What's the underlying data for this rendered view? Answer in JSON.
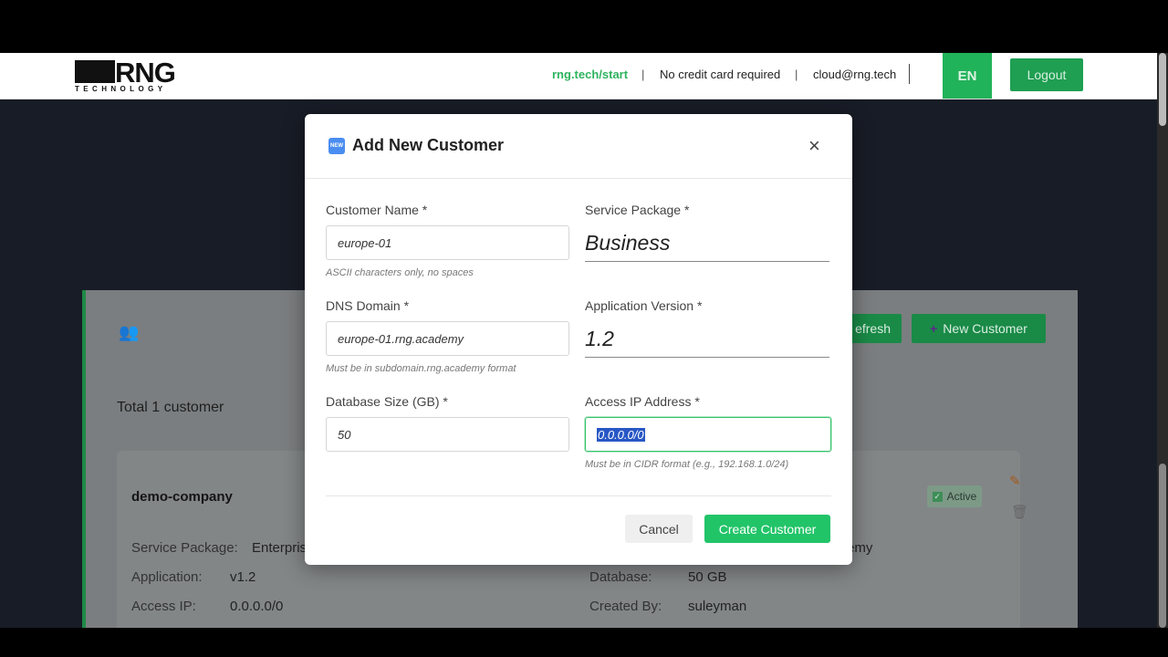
{
  "header": {
    "logo_text": "RNG",
    "logo_sub": "TECHNOLOGY",
    "start_link": "rng.tech/start",
    "sep1": "|",
    "promo": "No credit card required",
    "sep2": "|",
    "email": "cloud@rng.tech",
    "lang": "EN",
    "logout": "Logout"
  },
  "panel": {
    "refresh_label": "efresh",
    "new_customer_label": "New Customer",
    "total": "Total 1 customer",
    "card": {
      "name": "demo-company",
      "status": "Active",
      "service_label": "Service Package:",
      "service_value": "Enterpris",
      "domain_tail": "emy",
      "app_label": "Application:",
      "app_value": "v1.2",
      "ip_label": "Access IP:",
      "ip_value": "0.0.0.0/0",
      "db_label": "Database:",
      "db_value": "50 GB",
      "created_label": "Created By:",
      "created_value": "suleyman"
    }
  },
  "modal": {
    "title": "Add New Customer",
    "icon_text": "NEW",
    "close": "×",
    "fields": {
      "customer_name": {
        "label": "Customer Name *",
        "value": "europe-01",
        "hint": "ASCII characters only, no spaces"
      },
      "service_package": {
        "label": "Service Package *",
        "value": "Business"
      },
      "dns_domain": {
        "label": "DNS Domain *",
        "value": "europe-01.rng.academy",
        "hint": "Must be in subdomain.rng.academy format"
      },
      "app_version": {
        "label": "Application Version *",
        "value": "1.2"
      },
      "db_size": {
        "label": "Database Size (GB) *",
        "value": "50"
      },
      "access_ip": {
        "label": "Access IP Address *",
        "value": "0.0.0.0/0",
        "hint": "Must be in CIDR format (e.g., 192.168.1.0/24)"
      }
    },
    "cancel": "Cancel",
    "create": "Create Customer"
  },
  "colors": {
    "accent": "#22c468",
    "brand_green": "#2fb35f",
    "selection": "#2857c5"
  }
}
